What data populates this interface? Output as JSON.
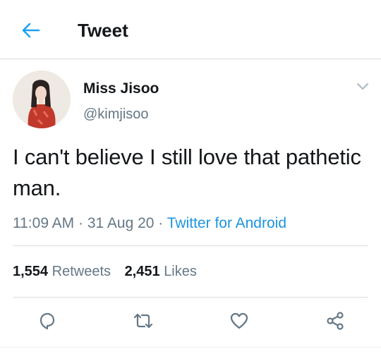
{
  "header": {
    "title": "Tweet",
    "back_icon": "arrow-left-icon"
  },
  "colors": {
    "accent": "#1da1f2",
    "link": "#1b95e0",
    "secondary_text": "#657786",
    "text": "#14171a"
  },
  "author": {
    "name": "Miss Jisoo",
    "handle": "@kimjisoo"
  },
  "tweet": {
    "text": "I can't believe I still love that pathetic man.",
    "time": "11:09 AM",
    "separator": "·",
    "date": "31 Aug 20",
    "source": "Twitter for Android"
  },
  "stats": {
    "retweets_count": "1,554",
    "retweets_label": "Retweets",
    "likes_count": "2,451",
    "likes_label": "Likes"
  },
  "actions": [
    "reply-icon",
    "retweet-icon",
    "like-icon",
    "share-icon"
  ]
}
